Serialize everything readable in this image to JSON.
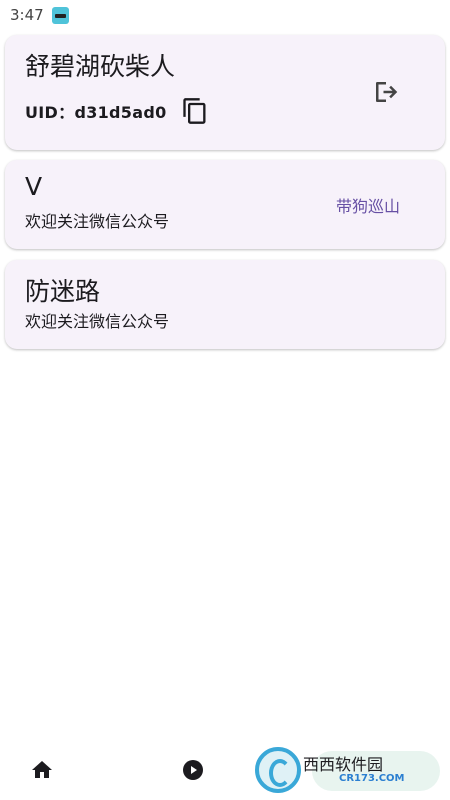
{
  "status_bar": {
    "time": "3:47",
    "app_icon": "sunglasses-app-icon"
  },
  "user_card": {
    "name": "舒碧湖砍柴人",
    "uid_label": "UID：",
    "uid_value": "d31d5ad0",
    "copy_icon": "copy-icon",
    "logout_icon": "logout-icon"
  },
  "cards": [
    {
      "title": "V",
      "subtitle": "欢迎关注微信公众号",
      "action": "带狗巡山"
    },
    {
      "title": "防迷路",
      "subtitle": "欢迎关注微信公众号"
    }
  ],
  "bottom_nav": {
    "items": [
      {
        "icon": "home-icon"
      },
      {
        "icon": "play-icon"
      }
    ]
  },
  "watermark": {
    "logo_text": "西西软件园",
    "domain": "CR173.COM"
  },
  "colors": {
    "card_bg": "#f7f2fa",
    "accent": "#6750a4",
    "text": "#1c1b1f"
  }
}
